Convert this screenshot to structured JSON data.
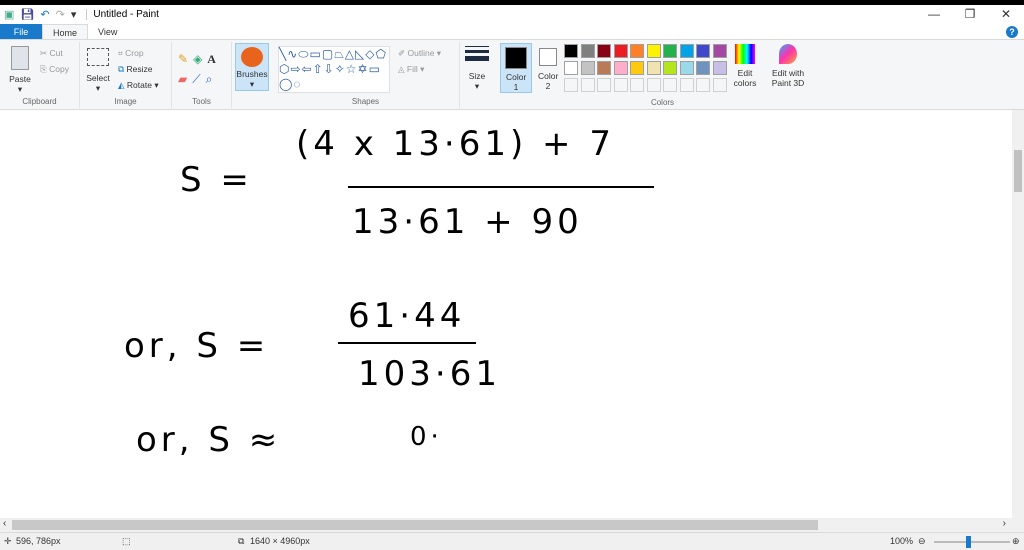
{
  "window": {
    "title": "Untitled - Paint",
    "minimize": "—",
    "restore": "❐",
    "close": "✕",
    "help": "?"
  },
  "tabs": [
    "File",
    "Home",
    "View"
  ],
  "clipboard": {
    "paste": "Paste",
    "cut": "Cut",
    "copy": "Copy",
    "label": "Clipboard"
  },
  "image": {
    "select": "Select",
    "crop": "Crop",
    "resize": "Resize",
    "rotate": "Rotate ▾",
    "label": "Image"
  },
  "tools": {
    "label": "Tools",
    "text": "A"
  },
  "brushes": {
    "label": "Brushes"
  },
  "shapes": {
    "label": "Shapes",
    "outline": "Outline ▾",
    "fill": "Fill ▾",
    "glyphs": "╲∿⬭▭▢⏢△◺◇⬠⬡⇨⇦⇧⇩✧☆✡▭◯◌"
  },
  "size": {
    "label": "Size"
  },
  "colors": {
    "color1": "Color 1",
    "color2": "Color 2",
    "edit": "Edit colors",
    "label": "Colors",
    "paint3d": "Edit with Paint 3D",
    "palette_row1": [
      "#000000",
      "#7f7f7f",
      "#880015",
      "#ed1c24",
      "#ff7f27",
      "#fff200",
      "#22b14c",
      "#00a2e8",
      "#3f48cc",
      "#a349a4"
    ],
    "palette_row2": [
      "#ffffff",
      "#c3c3c3",
      "#b97a57",
      "#ffaec9",
      "#ffc90e",
      "#efe4b0",
      "#b5e61d",
      "#99d9ea",
      "#7092be",
      "#c8bfe7"
    ]
  },
  "canvas": {
    "line1_lhs": "S =",
    "line1_num": "(4 x 13·61) + 7",
    "line1_den": "13·61 + 90",
    "line2_lhs": "or, S =",
    "line2_num": "61·44",
    "line2_den": "103·61",
    "line3": "or, S ≈",
    "line3_val": "0·"
  },
  "status": {
    "cursor": "596, 786px",
    "size": "1640 × 4960px",
    "zoom": "100%"
  }
}
